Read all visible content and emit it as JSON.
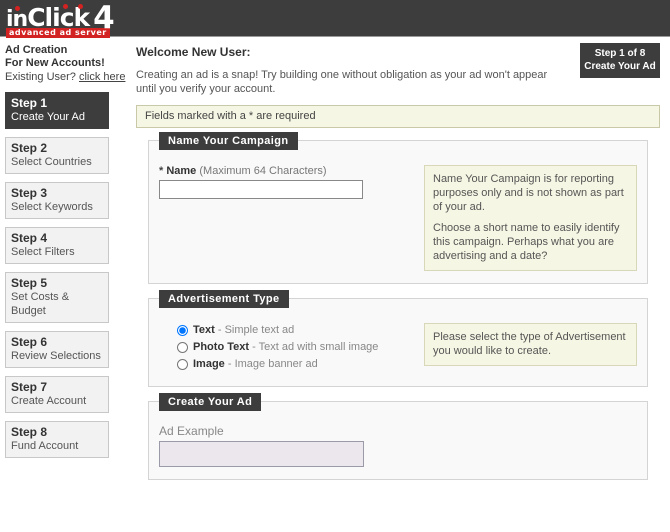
{
  "brand": {
    "name_part1": "in",
    "name_part2": "Click",
    "name_number": "4",
    "tagline": "advanced ad server",
    "dark": "#3d3d3d",
    "accent": "#d32222"
  },
  "sidebar": {
    "title_line1": "Ad Creation",
    "title_line2": "For New Accounts!",
    "existing_user_text": "Existing User?",
    "existing_user_link": "click here",
    "steps": [
      {
        "num": "Step 1",
        "label": "Create Your Ad",
        "active": true
      },
      {
        "num": "Step 2",
        "label": "Select Countries",
        "active": false
      },
      {
        "num": "Step 3",
        "label": "Select Keywords",
        "active": false
      },
      {
        "num": "Step 4",
        "label": "Select Filters",
        "active": false
      },
      {
        "num": "Step 5",
        "label": "Set Costs & Budget",
        "active": false
      },
      {
        "num": "Step 6",
        "label": "Review Selections",
        "active": false
      },
      {
        "num": "Step 7",
        "label": "Create Account",
        "active": false
      },
      {
        "num": "Step 8",
        "label": "Fund Account",
        "active": false
      }
    ]
  },
  "main": {
    "welcome_title": "Welcome New User:",
    "welcome_text": "Creating an ad is a snap!  Try building one without obligation as your ad won't appear until you verify your account.",
    "step_badge_line1": "Step 1 of 8",
    "step_badge_line2": "Create Your Ad",
    "required_note": "Fields marked with a * are required"
  },
  "campaign_panel": {
    "legend": "Name Your Campaign",
    "name_required_mark": "*",
    "name_label": "Name",
    "name_hint": "(Maximum 64 Characters)",
    "name_value": "",
    "name_placeholder": "",
    "help_p1": "Name Your Campaign is for reporting purposes only and is not shown as part of your ad.",
    "help_p2": "Choose a short name to easily identify this campaign. Perhaps what you are advertising and a date?"
  },
  "adtype_panel": {
    "legend": "Advertisement Type",
    "options": [
      {
        "name": "Text",
        "desc": "- Simple text ad",
        "selected": true
      },
      {
        "name": "Photo Text",
        "desc": "- Text ad with small image",
        "selected": false
      },
      {
        "name": "Image",
        "desc": "- Image banner ad",
        "selected": false
      }
    ],
    "help_p1": "Please select the type of Advertisement you would like to create."
  },
  "createad_panel": {
    "legend": "Create Your Ad",
    "ad_example_label": "Ad Example",
    "ad_example_value": ""
  }
}
